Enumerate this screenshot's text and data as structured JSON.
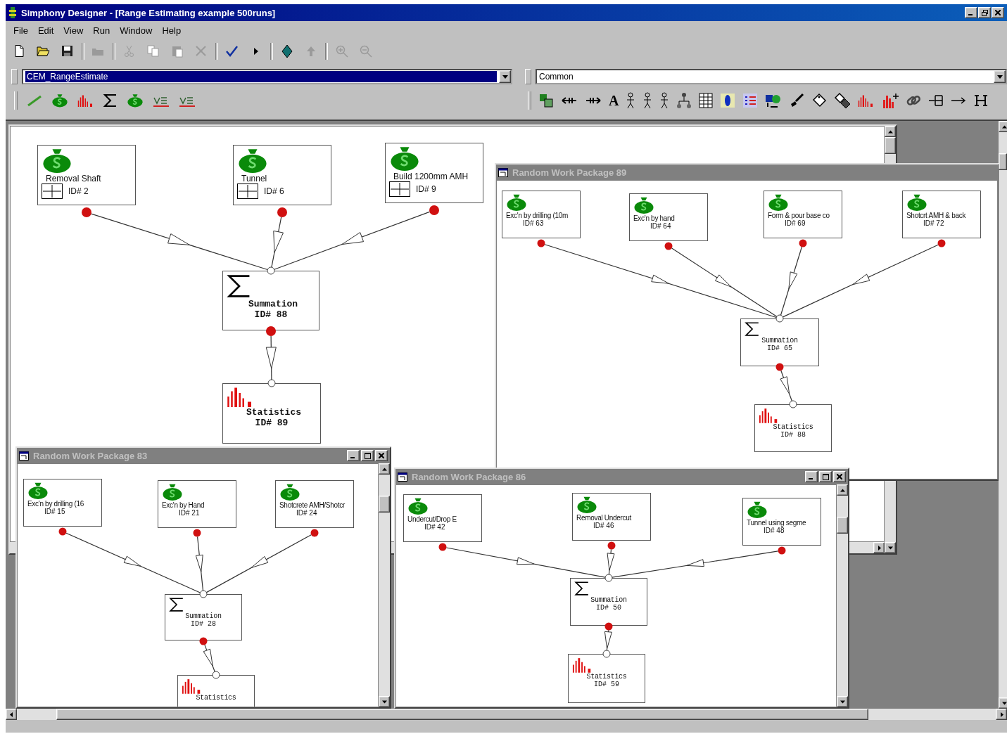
{
  "window": {
    "title": "Simphony Designer - [Range Estimating example 500runs]"
  },
  "menu": [
    "File",
    "Edit",
    "View",
    "Run",
    "Window",
    "Help"
  ],
  "toolbar": [
    {
      "kind": "new",
      "disabled": false
    },
    {
      "kind": "open",
      "disabled": false
    },
    {
      "kind": "save",
      "disabled": false
    },
    {
      "kind": "open_model",
      "disabled": true
    },
    {
      "kind": "cut",
      "disabled": true
    },
    {
      "kind": "copy",
      "disabled": true
    },
    {
      "kind": "paste",
      "disabled": true
    },
    {
      "kind": "delete",
      "disabled": true
    },
    {
      "kind": "check",
      "disabled": false
    },
    {
      "kind": "run",
      "disabled": false
    },
    {
      "kind": "diamond",
      "disabled": false
    },
    {
      "kind": "move_up",
      "disabled": true
    },
    {
      "kind": "zoom_in",
      "disabled": true
    },
    {
      "kind": "zoom_out",
      "disabled": true
    }
  ],
  "model_selector": {
    "value": "CEM_RangeEstimate",
    "highlighted": true
  },
  "palette_selector": {
    "value": "Common",
    "highlighted": false
  },
  "palette_text_tool": "A",
  "child_windows": [
    {
      "inputs": [
        {
          "label": "Removal Shaft",
          "id": "ID# 2",
          "expandable": true
        },
        {
          "label": "Tunnel",
          "id": "ID# 6",
          "expandable": true
        },
        {
          "label": "Build 1200mm AMH",
          "id": "ID# 9",
          "expandable": true
        }
      ],
      "summation": {
        "label": "Summation",
        "id": "ID# 88"
      },
      "statistics": {
        "label": "Statistics",
        "id": "ID# 89"
      }
    },
    {
      "title": "Random Work Package 89",
      "active": false,
      "inputs": [
        {
          "label": "Exc'n by drilling (10m",
          "id": "ID# 63"
        },
        {
          "label": "Exc'n by hand",
          "id": "ID# 64"
        },
        {
          "label": "Form & pour base co",
          "id": "ID# 69"
        },
        {
          "label": "Shotcrt AMH & back",
          "id": "ID# 72"
        }
      ],
      "summation": {
        "label": "Summation",
        "id": "ID# 65"
      },
      "statistics": {
        "label": "Statistics",
        "id": "ID# 88"
      }
    },
    {
      "title": "Random Work Package 83",
      "active": false,
      "inputs": [
        {
          "label": "Exc'n by drilling (16",
          "id": "ID# 15"
        },
        {
          "label": "Exc'n by Hand",
          "id": "ID# 21"
        },
        {
          "label": "Shotcrete AMH/Shotcr",
          "id": "ID# 24"
        }
      ],
      "summation": {
        "label": "Summation",
        "id": "ID# 28"
      },
      "statistics": {
        "label": "Statistics"
      }
    },
    {
      "title": "Random Work Package 86",
      "active": false,
      "inputs": [
        {
          "label": "Undercut/Drop E",
          "id": "ID# 42"
        },
        {
          "label": "Removal Undercut",
          "id": "ID# 46"
        },
        {
          "label": "Tunnel using segme",
          "id": "ID# 48"
        }
      ],
      "summation": {
        "label": "Summation",
        "id": "ID# 50"
      },
      "statistics": {
        "label": "Statistics",
        "id": "ID# 59"
      }
    }
  ]
}
